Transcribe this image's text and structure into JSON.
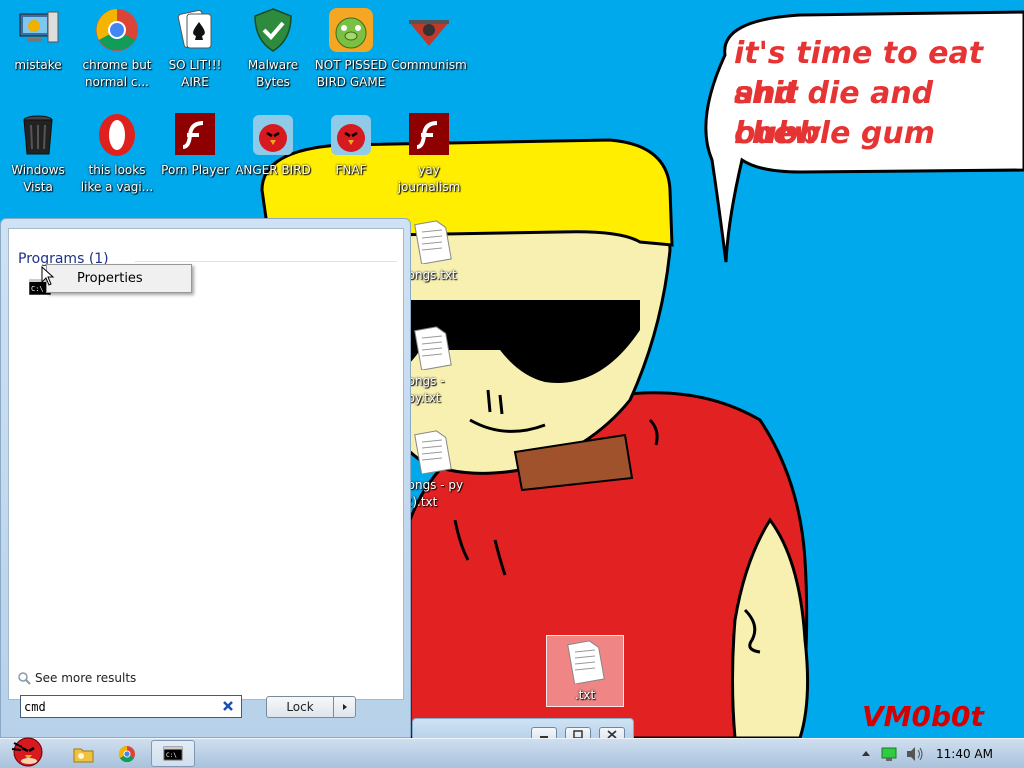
{
  "desktop": {
    "icons": [
      {
        "label": "mistake",
        "icon": "computer-icon"
      },
      {
        "label": "chrome but normal c...",
        "icon": "chrome-icon"
      },
      {
        "label": "SO LIT!!! AIRE",
        "icon": "solitaire-icon"
      },
      {
        "label": "Malware Bytes",
        "icon": "shield-icon"
      },
      {
        "label": "NOT PISSED BIRD GAME",
        "icon": "green-pig-icon"
      },
      {
        "label": "Communism",
        "icon": "emblem-icon"
      },
      {
        "label": "Windows Vista",
        "icon": "recycle-bin-icon"
      },
      {
        "label": "this looks like a vagi...",
        "icon": "opera-icon"
      },
      {
        "label": "Porn Player",
        "icon": "flash-icon"
      },
      {
        "label": "ANGER BIRD",
        "icon": "red-bird-icon"
      },
      {
        "label": "FNAF",
        "icon": "red-bird-icon"
      },
      {
        "label": "yay journalism",
        "icon": "flash-icon"
      },
      {
        "label": "dongs.txt",
        "icon": "text-file-icon"
      },
      {
        "label": "dongs - opy.txt",
        "icon": "text-file-icon"
      },
      {
        "label": "dongs - py (2).txt",
        "icon": "text-file-icon"
      },
      {
        "label": ".txt",
        "icon": "text-file-icon"
      }
    ]
  },
  "wallpaper": {
    "speech_lines": [
      "it's time to eat shit",
      "and die and chew",
      "bubble gum"
    ],
    "signature": "VM0b0t",
    "colors": {
      "sky": "#00a8ec",
      "hair": "#ffee00",
      "skin": "#f7f0b0",
      "shirt": "#e22222",
      "text": "#e63333"
    }
  },
  "start_menu": {
    "programs_header": "Programs (1)",
    "result_icon": "cmd-icon",
    "context_menu": {
      "item": "Properties"
    },
    "see_more": "See more results",
    "search": {
      "value": "cmd",
      "clear_icon": "clear-x-icon"
    },
    "lock_button": "Lock",
    "lock_arrow_icon": "chevron-right-icon"
  },
  "window_controls": [
    "minimize-icon",
    "maximize-icon",
    "close-icon"
  ],
  "taskbar": {
    "start_icon": "angry-bird-start-icon",
    "pinned": [
      "explorer-icon",
      "chrome-icon",
      "cmd-icon"
    ],
    "tray": [
      "show-hidden-icon",
      "network-icon",
      "volume-icon"
    ],
    "clock": "11:40 AM"
  }
}
